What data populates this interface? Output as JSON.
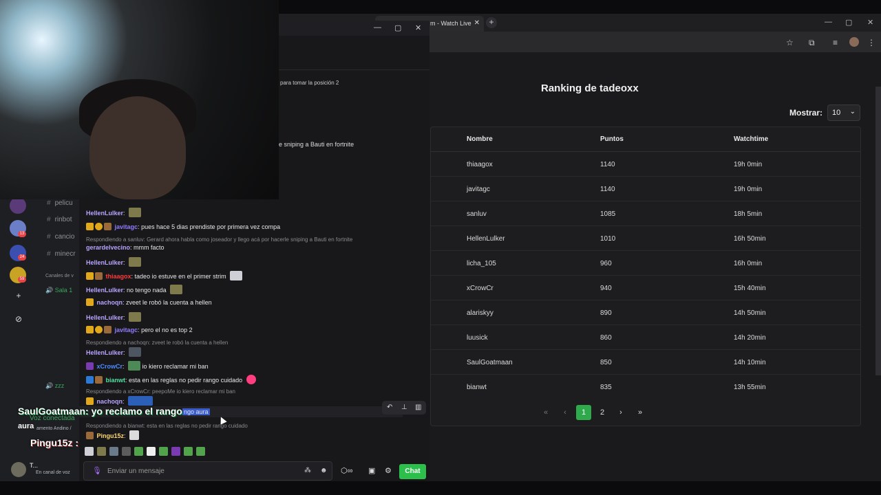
{
  "browser": {
    "tab_title": "m - Watch Live",
    "tab_close": "✕",
    "newtab": "+",
    "win_min": "—",
    "win_max": "▢",
    "win_close": "✕"
  },
  "ranking": {
    "title": "Ranking de tadeoxx",
    "show_label": "Mostrar:",
    "show_value": "10",
    "headers": [
      "Nombre",
      "Puntos",
      "Watchtime"
    ],
    "rows": [
      {
        "name": "thiaagox",
        "points": "1140",
        "watchtime": "19h 0min"
      },
      {
        "name": "javitagc",
        "points": "1140",
        "watchtime": "19h 0min"
      },
      {
        "name": "sanluv",
        "points": "1085",
        "watchtime": "18h 5min"
      },
      {
        "name": "HellenLulker",
        "points": "1010",
        "watchtime": "16h 50min"
      },
      {
        "name": "licha_105",
        "points": "960",
        "watchtime": "16h 0min"
      },
      {
        "name": "xCrowCr",
        "points": "940",
        "watchtime": "15h 40min"
      },
      {
        "name": "alariskyy",
        "points": "890",
        "watchtime": "14h 50min"
      },
      {
        "name": "luusick",
        "points": "860",
        "watchtime": "14h 20min"
      },
      {
        "name": "SaulGoatmaan",
        "points": "850",
        "watchtime": "14h 10min"
      },
      {
        "name": "bianwt",
        "points": "835",
        "watchtime": "13h 55min"
      }
    ],
    "pager": {
      "first": "«",
      "prev": "‹",
      "page1": "1",
      "page2": "2",
      "next": "›",
      "last": "»"
    }
  },
  "chat": {
    "pos_text": "para tomar la posición 2",
    "snipe_text": "e sniping a Bauti en fortnite",
    "messages": [
      {
        "user": "HellenLulker",
        "text": ""
      },
      {
        "user": "javitagc",
        "text": "pues hace 5 dias prendiste por primera vez compa"
      },
      {
        "reply": "Respondiendo a sanluv: Gerard ahora habla como joseador y llego acá por hacerle sniping a Bauti en fortnite"
      },
      {
        "user": "gerardelvecino",
        "text": "mmm facto"
      },
      {
        "user": "HellenLulker",
        "text": ""
      },
      {
        "user": "thiaagox",
        "text": "tadeo io estuve en el primer strim"
      },
      {
        "user": "HellenLulker",
        "text": "no tengo nada"
      },
      {
        "user": "nachoqn",
        "text": "zveet le robó la cuenta a hellen"
      },
      {
        "user": "HellenLulker",
        "text": ""
      },
      {
        "user": "javitagc",
        "text": "pero el no es top 2"
      },
      {
        "reply": "Respondiendo a nachoqn: zveet le robó la cuenta a hellen"
      },
      {
        "user": "HellenLulker",
        "text": ""
      },
      {
        "user": "xCrowCr",
        "text": "io kiero reclamar mi ban"
      },
      {
        "user": "bianwt",
        "text": "esta en las reglas no pedir rango cuidado"
      },
      {
        "reply": "Respondiendo a xCrowCr: peepoMe io kiero reclamar mi ban"
      },
      {
        "user": "nachoqn",
        "text": ""
      },
      {
        "hl": "ngo aura"
      },
      {
        "reply": "Respondiendo a bianwt: esta en las reglas no pedir rango cuidado"
      },
      {
        "user": "Pingu15z",
        "text": ""
      }
    ],
    "input_placeholder": "Enviar un mensaje",
    "chat_button": "Chat"
  },
  "discord": {
    "channels": [
      "pelicu",
      "rinbot",
      "cancio",
      "minecr"
    ],
    "category": "Canales de v",
    "voice1": "Sala 1",
    "voice2": "zzz",
    "badges": [
      "13",
      "24",
      "59"
    ],
    "voice_status": "Voz conectada",
    "voice_sub": "amento Andino /",
    "user_name": "T...",
    "user_sub": "En canal de voz"
  },
  "overlay": {
    "line1_user": "SaulGoatmaan",
    "line1_text": ": yo reclamo el rango",
    "line1_aura": "aura",
    "line2": "Pingu15z :"
  }
}
